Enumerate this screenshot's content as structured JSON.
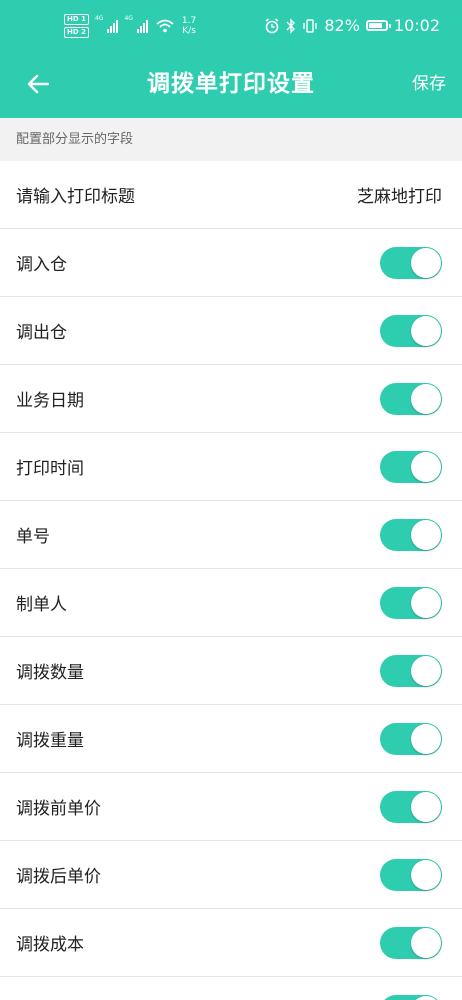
{
  "colors": {
    "accent": "#2fcdb0",
    "section_bg": "#f2f2f2",
    "divider": "#e5e5e5"
  },
  "status_bar": {
    "hd1": "HD 1",
    "hd2": "HD 2",
    "net1": "4G",
    "net2": "4G",
    "speed_value": "1.7",
    "speed_unit": "K/s",
    "battery_percent": "82%",
    "battery_level": 0.82,
    "time": "10:02",
    "icons": [
      "alarm-icon",
      "bluetooth-icon",
      "vibrate-icon",
      "battery-icon",
      "wifi-icon",
      "signal-icon"
    ]
  },
  "header": {
    "title": "调拨单打印设置",
    "back_icon": "back-arrow-icon",
    "save_label": "保存"
  },
  "section": {
    "label": "配置部分显示的字段"
  },
  "print_title": {
    "label": "请输入打印标题",
    "value": "芝麻地打印"
  },
  "fields": [
    {
      "label": "调入仓",
      "enabled": true
    },
    {
      "label": "调出仓",
      "enabled": true
    },
    {
      "label": "业务日期",
      "enabled": true
    },
    {
      "label": "打印时间",
      "enabled": true
    },
    {
      "label": "单号",
      "enabled": true
    },
    {
      "label": "制单人",
      "enabled": true
    },
    {
      "label": "调拨数量",
      "enabled": true
    },
    {
      "label": "调拨重量",
      "enabled": true
    },
    {
      "label": "调拨前单价",
      "enabled": true
    },
    {
      "label": "调拨后单价",
      "enabled": true
    },
    {
      "label": "调拨成本",
      "enabled": true
    },
    {
      "label": "",
      "enabled": true
    }
  ]
}
